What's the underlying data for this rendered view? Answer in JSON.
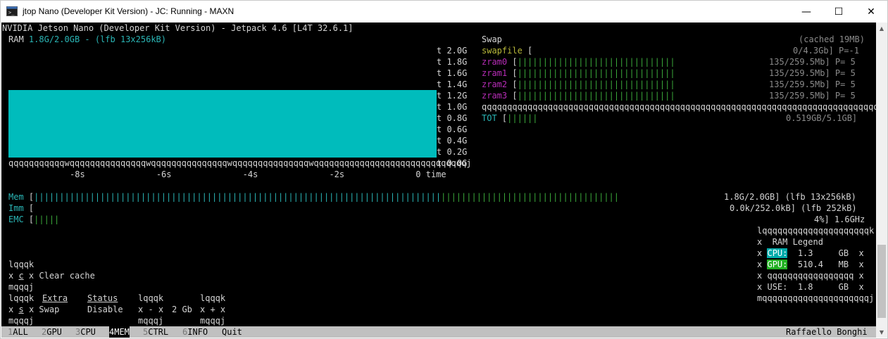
{
  "window": {
    "title": "jtop Nano (Developer Kit Version) - JC: Running - MAXN",
    "minimize": "—",
    "maximize": "☐",
    "close": "✕"
  },
  "header": "NVIDIA Jetson Nano (Developer Kit Version) - Jetpack 4.6 [L4T 32.6.1]",
  "ram_chart": {
    "label": "RAM",
    "value": "1.8G/2.0GB - (lfb 13x256kB)",
    "y_ticks": [
      "t 2.0G",
      "t 1.8G",
      "t 1.6G",
      "t 1.4G",
      "t 1.2G",
      "t 1.0G",
      "t 0.8G",
      "t 0.6G",
      "t 0.4G",
      "t 0.2G",
      "t 0.0G"
    ],
    "axis_line": "qqqqqqqqqqqwqqqqqqqqqqqqqqqwqqqqqqqqqqqqqqqwqqqqqqqqqqqqqqqwqqqqqqqqqqqqqqqqqqqqqqqqqqqqqqj",
    "x_labels": "-8s              -6s              -4s              -2s              0 time"
  },
  "swap": {
    "title": "Swap",
    "cached": "(cached 19MB)",
    "rows": [
      {
        "name": "swapfile",
        "bar": "[",
        "value": "0/4.3Gb] P=-1"
      },
      {
        "name": "zram0",
        "bar": "[|||||||||||||||||||||||||||||||",
        "value": "135/259.5Mb] P= 5"
      },
      {
        "name": "zram1",
        "bar": "[|||||||||||||||||||||||||||||||",
        "value": "135/259.5Mb] P= 5"
      },
      {
        "name": "zram2",
        "bar": "[|||||||||||||||||||||||||||||||",
        "value": "135/259.5Mb] P= 5"
      },
      {
        "name": "zram3",
        "bar": "[|||||||||||||||||||||||||||||||",
        "value": "135/259.5Mb] P= 5"
      }
    ],
    "separator": "qqqqqqqqqqqqqqqqqqqqqqqqqqqqqqqqqqqqqqqqqqqqqqqqqqqqqqqqqqqqqqqqqqqqqqqqqqqqqqqqqqqqqqqqqqqqqq",
    "total": {
      "name": "TOT",
      "bar": "[||||||",
      "value": "0.519GB/5.1GB]"
    }
  },
  "meters": {
    "mem": {
      "label": "Mem",
      "bracket": "[",
      "bar_cyan": "||||||||||||||||||||||||||||||||||||||||||||||||||||||||||||||||||||||||||||||||",
      "bar_green": "|||||||||||||||||||||||||||||||||||",
      "value": "1.8G/2.0GB] (lfb 13x256kB)"
    },
    "imm": {
      "label": "Imm",
      "bracket": "[",
      "value": "0.0k/252.0kB] (lfb 252kB)"
    },
    "emc": {
      "label": "EMC",
      "bracket": "[",
      "bar": "|||||",
      "value": "4%] 1.6GHz"
    }
  },
  "legend": {
    "top": "lqqqqqqqqqqqqqqqqqqqqqk",
    "title": "RAM Legend",
    "cpu": {
      "label": "CPU:",
      "value": "1.3",
      "unit": "GB"
    },
    "gpu": {
      "label": "GPU:",
      "value": "510.4",
      "unit": "MB"
    },
    "sep": "qqqqqqqqqqqqqqqqq",
    "use": {
      "label": "USE:",
      "value": "1.8",
      "unit": "GB"
    },
    "bottom": "mqqqqqqqqqqqqqqqqqqqqqj",
    "side": "x"
  },
  "controls": {
    "clear_top": "lqqqk",
    "clear_mid_pre": "x ",
    "clear_key": "c",
    "clear_mid_post": " x",
    "clear_label": "Clear cache",
    "clear_bottom": "mqqqj",
    "extra_title": "Extra",
    "status_title": "Status",
    "swap_top": "lqqqk",
    "swap_key": "s",
    "swap_label": "Swap",
    "swap_status": "Disable",
    "minus_top": "lqqqk",
    "minus_mid": "x - x",
    "size_value": "2 Gb",
    "plus_top": "lqqqk",
    "plus_mid": "x + x",
    "minus_bottom": "mqqqj",
    "plus_bottom": "mqqqj",
    "swap_bottom": "mqqqj"
  },
  "tabs": [
    {
      "num": "1",
      "label": "ALL"
    },
    {
      "num": "2",
      "label": "GPU"
    },
    {
      "num": "3",
      "label": "CPU"
    },
    {
      "num": "4",
      "label": "MEM"
    },
    {
      "num": "5",
      "label": "CTRL"
    },
    {
      "num": "6",
      "label": "INFO"
    },
    {
      "num": "",
      "label": "Quit"
    }
  ],
  "author": "Raffaello Bonghi",
  "colors": {
    "ram_fill": "#00bcbc",
    "cpu_highlight": "#00aaaa",
    "gpu_highlight": "#22b022",
    "terminal_bg": "#000000"
  }
}
